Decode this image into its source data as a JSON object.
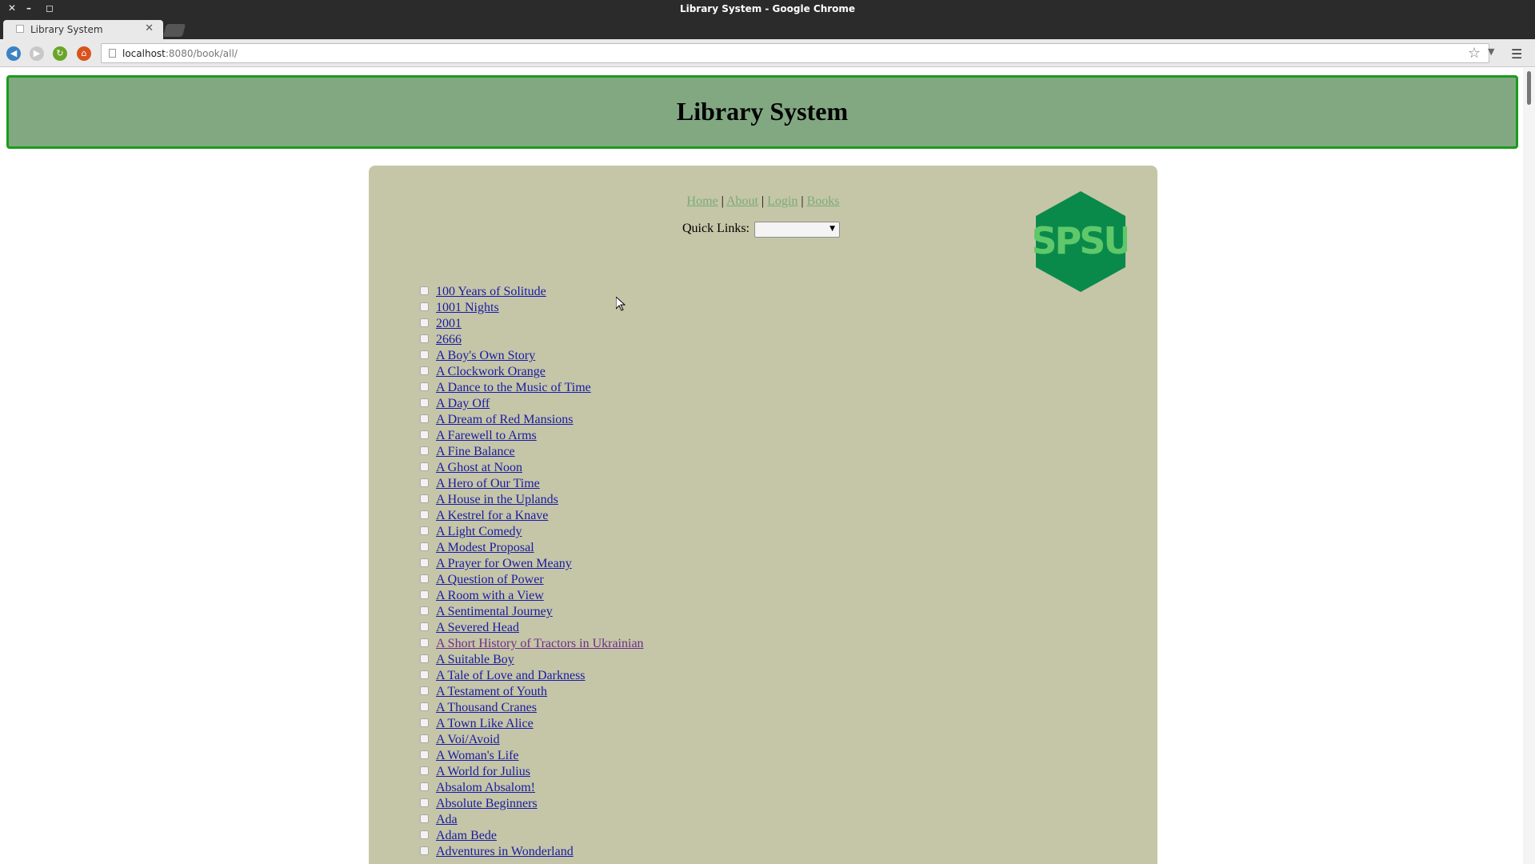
{
  "window": {
    "title": "Library System - Google Chrome"
  },
  "tab": {
    "label": "Library System"
  },
  "address_bar": {
    "host": "localhost",
    "path": ":8080/book/all/"
  },
  "header": {
    "title": "Library System"
  },
  "nav": {
    "links": [
      "Home",
      "About",
      "Login",
      "Books"
    ],
    "separator": "|"
  },
  "quick_links": {
    "label": "Quick Links:",
    "selected": ""
  },
  "logo": {
    "text": "SPSU",
    "color": "#0a8a4a"
  },
  "books": [
    "100 Years of Solitude",
    "1001 Nights",
    "2001",
    "2666",
    "A Boy's Own Story",
    "A Clockwork Orange",
    "A Dance to the Music of Time",
    "A Day Off",
    "A Dream of Red Mansions",
    "A Farewell to Arms",
    "A Fine Balance",
    "A Ghost at Noon",
    "A Hero of Our Time",
    "A House in the Uplands",
    "A Kestrel for a Knave",
    "A Light Comedy",
    "A Modest Proposal",
    "A Prayer for Owen Meany",
    "A Question of Power",
    "A Room with a View",
    "A Sentimental Journey",
    "A Severed Head",
    "A Short History of Tractors in Ukrainian",
    "A Suitable Boy",
    "A Tale of Love and Darkness",
    "A Testament of Youth",
    "A Thousand Cranes",
    "A Town Like Alice",
    "A Voi/Avoid",
    "A Woman's Life",
    "A World for Julius",
    "Absalom Absalom!",
    "Absolute Beginners",
    "Ada",
    "Adam Bede",
    "Adventures in Wonderland"
  ],
  "visited_index": 22,
  "colors": {
    "header_bg": "#82a882",
    "header_border": "#1b9b1b",
    "panel_bg": "#c5c6a7",
    "link": "#1a1aa6",
    "nav_link": "#7aab7a"
  }
}
